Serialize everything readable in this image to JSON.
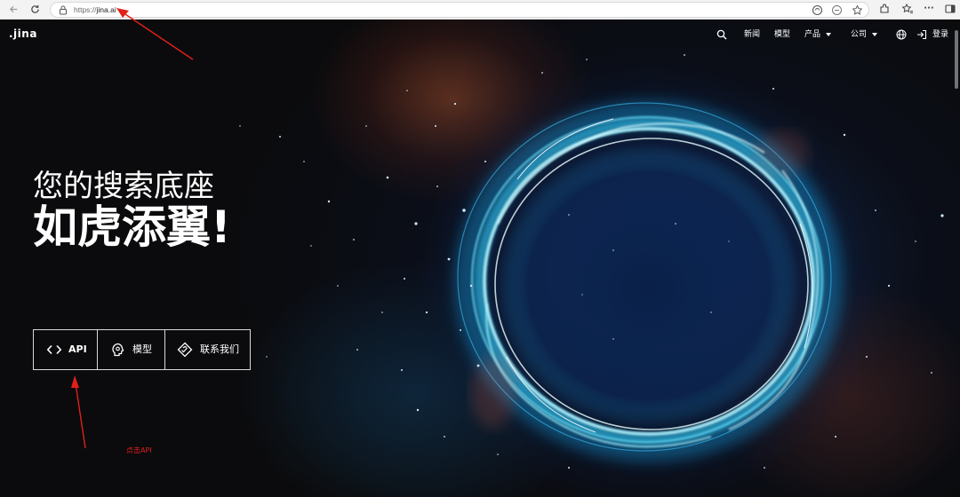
{
  "browser": {
    "url_scheme": "https://",
    "url_host": "jina.ai",
    "icons": [
      "back-arrow-icon",
      "refresh-icon",
      "lock-icon",
      "read-aloud-icon",
      "tracking-icon",
      "favorite-star-icon",
      "extensions-icon",
      "favorites-icon",
      "more-icon",
      "sidebar-icon"
    ]
  },
  "site": {
    "logo": ".jina",
    "nav": {
      "news": "新闻",
      "models": "模型",
      "products": "产品",
      "company": "公司",
      "login": "登录"
    }
  },
  "hero": {
    "line1": "您的搜索底座",
    "line2": "如虎添翼!"
  },
  "cta": {
    "api": "API",
    "models": "模型",
    "contact": "联系我们"
  },
  "annotation": {
    "text": "点击API",
    "color": "#e0201a"
  }
}
